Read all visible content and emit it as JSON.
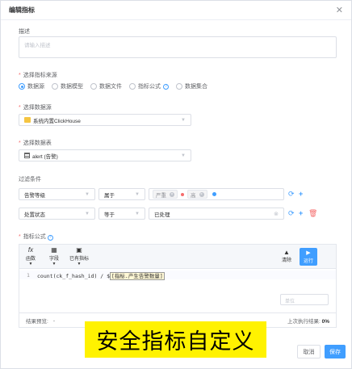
{
  "dialog": {
    "title": "编辑指标",
    "close_icon": "close-icon"
  },
  "description": {
    "label": "描述",
    "placeholder": "请输入描述"
  },
  "source": {
    "label": "选择指标来源",
    "options": [
      "数据源",
      "数据模型",
      "数据文件",
      "指标公式",
      "数据集合"
    ],
    "selected": "数据源"
  },
  "datasource": {
    "label": "选择数据源",
    "value": "系统内置ClickHouse"
  },
  "datatable": {
    "label": "选择数据表",
    "value": "alert (告警)"
  },
  "filters": {
    "label": "过滤条件",
    "rows": [
      {
        "field": "告警等级",
        "op": "属于",
        "tags": [
          "严重",
          "高"
        ]
      },
      {
        "field": "处置状态",
        "op": "等于",
        "value": "已处理"
      }
    ]
  },
  "formula": {
    "label": "指标公式",
    "toolbar": {
      "func": "函数",
      "field": "字段",
      "existing": "已有指标",
      "clear": "清除",
      "run": "运行"
    },
    "line_number": "1",
    "code_prefix": "count(ck_f_hash_id) / $",
    "code_token": "[指标.产生告警数量]",
    "unit_placeholder": "单位",
    "preview_label": "结果预览:",
    "preview_value": "-",
    "last_result_label": "上次执行结果:",
    "last_result_value": "0%"
  },
  "overlay_text": "安全指标自定义",
  "footer": {
    "cancel": "取消",
    "save": "保存"
  },
  "colors": {
    "primary": "#409eff",
    "danger": "#f56c6c",
    "highlight": "#fff200"
  }
}
